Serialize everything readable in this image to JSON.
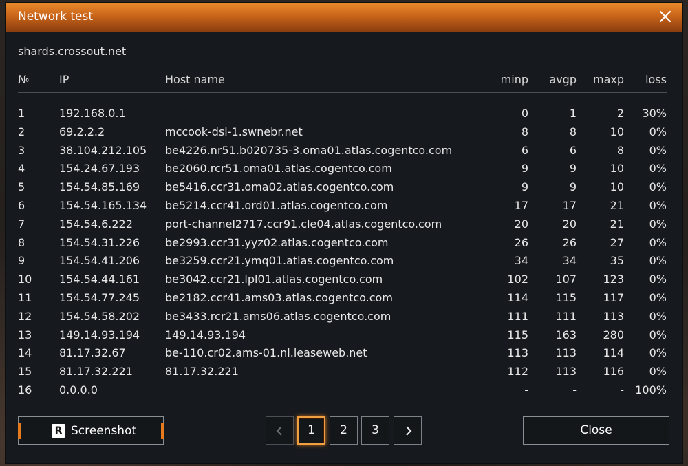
{
  "window": {
    "title": "Network test"
  },
  "server": "shards.crossout.net",
  "columns": {
    "num": "№",
    "ip": "IP",
    "host": "Host name",
    "minp": "minp",
    "avgp": "avgp",
    "maxp": "maxp",
    "loss": "loss"
  },
  "rows": [
    {
      "num": "1",
      "ip": "192.168.0.1",
      "host": "",
      "minp": "0",
      "avgp": "1",
      "maxp": "2",
      "loss": "30%"
    },
    {
      "num": "2",
      "ip": "69.2.2.2",
      "host": "mccook-dsl-1.swnebr.net",
      "minp": "8",
      "avgp": "8",
      "maxp": "10",
      "loss": "0%"
    },
    {
      "num": "3",
      "ip": "38.104.212.105",
      "host": "be4226.nr51.b020735-3.oma01.atlas.cogentco.com",
      "minp": "6",
      "avgp": "6",
      "maxp": "8",
      "loss": "0%"
    },
    {
      "num": "4",
      "ip": "154.24.67.193",
      "host": "be2060.rcr51.oma01.atlas.cogentco.com",
      "minp": "9",
      "avgp": "9",
      "maxp": "10",
      "loss": "0%"
    },
    {
      "num": "5",
      "ip": "154.54.85.169",
      "host": "be5416.ccr31.oma02.atlas.cogentco.com",
      "minp": "9",
      "avgp": "9",
      "maxp": "10",
      "loss": "0%"
    },
    {
      "num": "6",
      "ip": "154.54.165.134",
      "host": "be5214.ccr41.ord01.atlas.cogentco.com",
      "minp": "17",
      "avgp": "17",
      "maxp": "21",
      "loss": "0%"
    },
    {
      "num": "7",
      "ip": "154.54.6.222",
      "host": "port-channel2717.ccr91.cle04.atlas.cogentco.com",
      "minp": "20",
      "avgp": "20",
      "maxp": "21",
      "loss": "0%"
    },
    {
      "num": "8",
      "ip": "154.54.31.226",
      "host": "be2993.ccr31.yyz02.atlas.cogentco.com",
      "minp": "26",
      "avgp": "26",
      "maxp": "27",
      "loss": "0%"
    },
    {
      "num": "9",
      "ip": "154.54.41.206",
      "host": "be3259.ccr21.ymq01.atlas.cogentco.com",
      "minp": "34",
      "avgp": "34",
      "maxp": "35",
      "loss": "0%"
    },
    {
      "num": "10",
      "ip": "154.54.44.161",
      "host": "be3042.ccr21.lpl01.atlas.cogentco.com",
      "minp": "102",
      "avgp": "107",
      "maxp": "123",
      "loss": "0%"
    },
    {
      "num": "11",
      "ip": "154.54.77.245",
      "host": "be2182.ccr41.ams03.atlas.cogentco.com",
      "minp": "114",
      "avgp": "115",
      "maxp": "117",
      "loss": "0%"
    },
    {
      "num": "12",
      "ip": "154.54.58.202",
      "host": "be3433.rcr21.ams06.atlas.cogentco.com",
      "minp": "111",
      "avgp": "111",
      "maxp": "113",
      "loss": "0%"
    },
    {
      "num": "13",
      "ip": "149.14.93.194",
      "host": "149.14.93.194",
      "minp": "115",
      "avgp": "163",
      "maxp": "280",
      "loss": "0%"
    },
    {
      "num": "14",
      "ip": "81.17.32.67",
      "host": "be-110.cr02.ams-01.nl.leaseweb.net",
      "minp": "113",
      "avgp": "113",
      "maxp": "114",
      "loss": "0%"
    },
    {
      "num": "15",
      "ip": "81.17.32.221",
      "host": "81.17.32.221",
      "minp": "112",
      "avgp": "113",
      "maxp": "116",
      "loss": "0%"
    },
    {
      "num": "16",
      "ip": "0.0.0.0",
      "host": "",
      "minp": "-",
      "avgp": "-",
      "maxp": "-",
      "loss": "100%"
    }
  ],
  "footer": {
    "screenshot_key": "R",
    "screenshot_label": "Screenshot",
    "pages": [
      "1",
      "2",
      "3"
    ],
    "current_page": "1",
    "close_label": "Close"
  },
  "colors": {
    "accent": "#e87a1e",
    "background": "#161a1e",
    "text": "#e8e8e8"
  },
  "icons": {
    "close": "close-x-icon",
    "prev": "chevron-left-icon",
    "next": "chevron-right-icon"
  }
}
